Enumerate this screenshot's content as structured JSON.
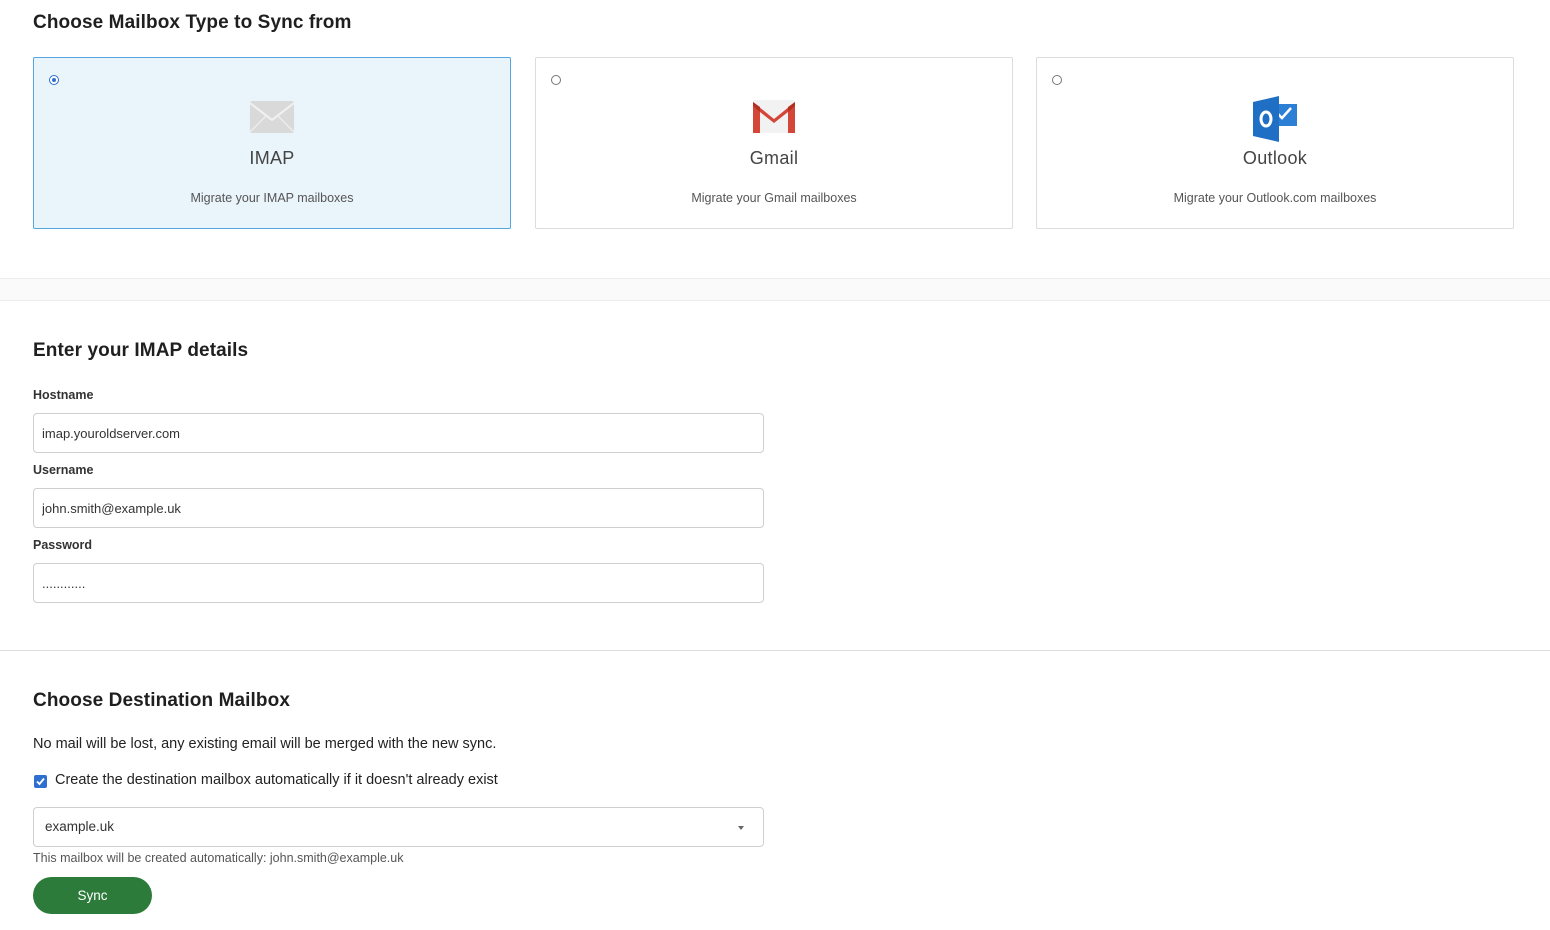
{
  "section1": {
    "title": "Choose Mailbox Type to Sync from"
  },
  "mailbox_types": [
    {
      "name": "IMAP",
      "description": "Migrate your IMAP mailboxes",
      "selected": true,
      "icon": "envelope-icon"
    },
    {
      "name": "Gmail",
      "description": "Migrate your Gmail mailboxes",
      "selected": false,
      "icon": "gmail-icon"
    },
    {
      "name": "Outlook",
      "description": "Migrate your Outlook.com mailboxes",
      "selected": false,
      "icon": "outlook-icon"
    }
  ],
  "imap": {
    "title": "Enter your IMAP details",
    "hostname_label": "Hostname",
    "hostname_value": "imap.youroldserver.com",
    "username_label": "Username",
    "username_value": "john.smith@example.uk",
    "password_label": "Password",
    "password_value": "............"
  },
  "destination": {
    "title": "Choose Destination Mailbox",
    "note": "No mail will be lost, any existing email will be merged with the new sync.",
    "checkbox_label": "Create the destination mailbox automatically if it doesn't already exist",
    "checkbox_checked": true,
    "domain_selected": "example.uk",
    "hint": "This mailbox will be created automatically: john.smith@example.uk",
    "sync_label": "Sync"
  },
  "colors": {
    "selected_card_bg": "#eaf4fb",
    "selected_card_border": "#55a6e0",
    "accent_blue": "#2f6fcf",
    "sync_button": "#2c7b3a",
    "gmail_red": "#d44638",
    "outlook_blue": "#1f6fc5"
  }
}
